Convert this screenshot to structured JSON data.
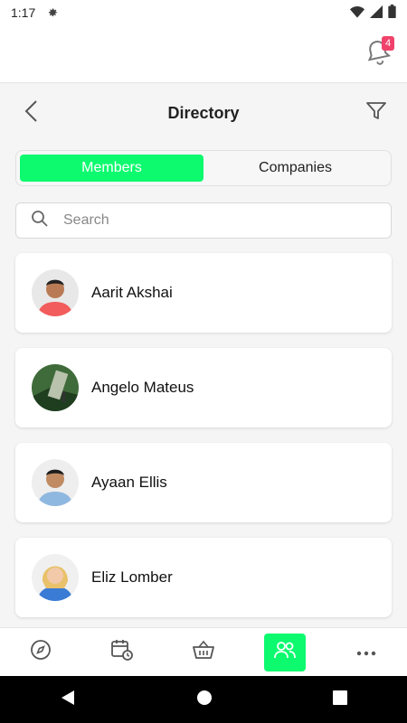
{
  "status_bar": {
    "time": "1:17",
    "icons": [
      "gear-icon",
      "wifi-icon",
      "cell-signal-icon",
      "battery-icon"
    ]
  },
  "notifications": {
    "count": "4",
    "icon": "notification-bell-icon",
    "badge_color": "#f0426a"
  },
  "header": {
    "title": "Directory",
    "back_icon": "chevron-left-icon",
    "filter_icon": "filter-icon"
  },
  "tabs": [
    {
      "label": "Members",
      "active": true
    },
    {
      "label": "Companies",
      "active": false
    }
  ],
  "search": {
    "placeholder": "Search",
    "value": ""
  },
  "members": [
    {
      "name": "Aarit Akshai",
      "avatar": "avatar-photo"
    },
    {
      "name": "Angelo Mateus",
      "avatar": "avatar-photo"
    },
    {
      "name": "Ayaan Ellis",
      "avatar": "avatar-photo"
    },
    {
      "name": "Eliz Lomber",
      "avatar": "avatar-photo"
    }
  ],
  "bottom_nav": [
    {
      "icon": "compass-icon",
      "active": false
    },
    {
      "icon": "calendar-clock-icon",
      "active": false
    },
    {
      "icon": "basket-icon",
      "active": false
    },
    {
      "icon": "people-icon",
      "active": true
    },
    {
      "icon": "more-icon",
      "active": false
    }
  ],
  "colors": {
    "accent": "#0dfa6f",
    "background": "#f5f5f5",
    "card": "#ffffff"
  }
}
